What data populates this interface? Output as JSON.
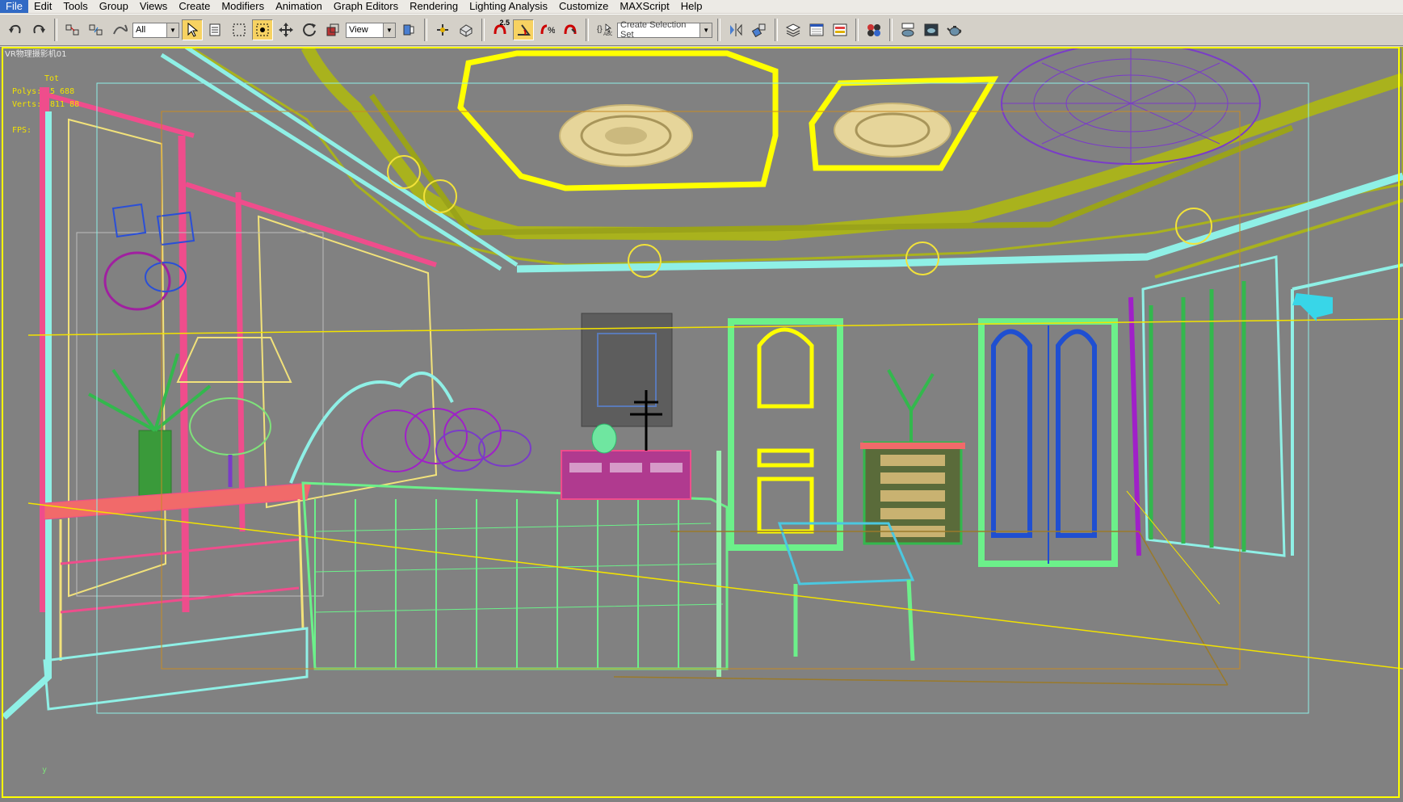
{
  "menu": [
    "File",
    "Edit",
    "Tools",
    "Group",
    "Views",
    "Create",
    "Modifiers",
    "Animation",
    "Graph Editors",
    "Rendering",
    "Lighting Analysis",
    "Customize",
    "MAXScript",
    "Help"
  ],
  "toolbar": {
    "filter_value": "All",
    "ref_coord_value": "View",
    "snap_label": "2.5",
    "selection_set_placeholder": "Create Selection Set"
  },
  "viewport": {
    "label": "VR物理摄影机01",
    "stats": {
      "total": "Tot",
      "polys": "Polys:",
      "polys_val": "5 688",
      "verts": "Verts:",
      "verts_val": "811 88",
      "fps": "FPS:"
    },
    "axis_y": "y"
  },
  "colors": {
    "ceiling_olive": "#a9b21d",
    "yellow_frame": "#ffff00",
    "cyan": "#8ff0e6",
    "pink": "#ef4d8c",
    "green_mesh": "#6cf08a",
    "blue_door": "#1f4fd1"
  }
}
